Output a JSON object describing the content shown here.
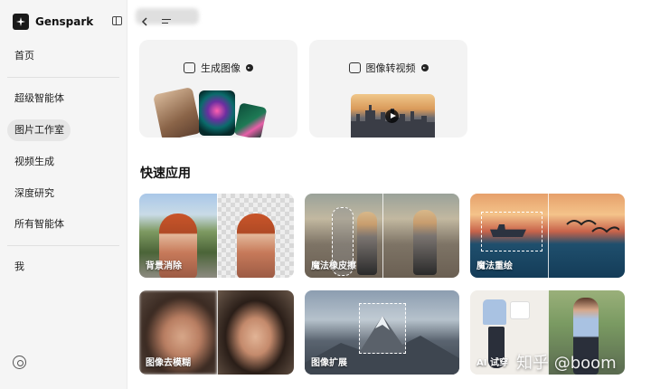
{
  "brand": {
    "name": "Genspark",
    "logo_icon": "genspark-logo-icon"
  },
  "sidebar": {
    "items": [
      {
        "label": "首页"
      },
      {
        "label": "超级智能体"
      },
      {
        "label": "图片工作室",
        "active": true
      },
      {
        "label": "视频生成"
      },
      {
        "label": "深度研究"
      },
      {
        "label": "所有智能体"
      },
      {
        "label": "我"
      }
    ],
    "settings_icon": "settings-icon",
    "collapse_icon": "sidebar-collapse-icon"
  },
  "topbar": {
    "back_icon": "chevron-left-icon",
    "menu_icon": "menu-icon"
  },
  "cards": [
    {
      "label": "生成图像",
      "icon": "image-generate-icon"
    },
    {
      "label": "图像转视频",
      "icon": "video-icon"
    }
  ],
  "quick_apps": {
    "title": "快速应用",
    "tiles": [
      {
        "label": "背景消除"
      },
      {
        "label": "魔法橡皮擦"
      },
      {
        "label": "魔法重绘"
      },
      {
        "label": "图像去模糊"
      },
      {
        "label": "图像扩展"
      },
      {
        "label": "AI 试穿"
      }
    ]
  },
  "watermark": "知乎 @boom"
}
